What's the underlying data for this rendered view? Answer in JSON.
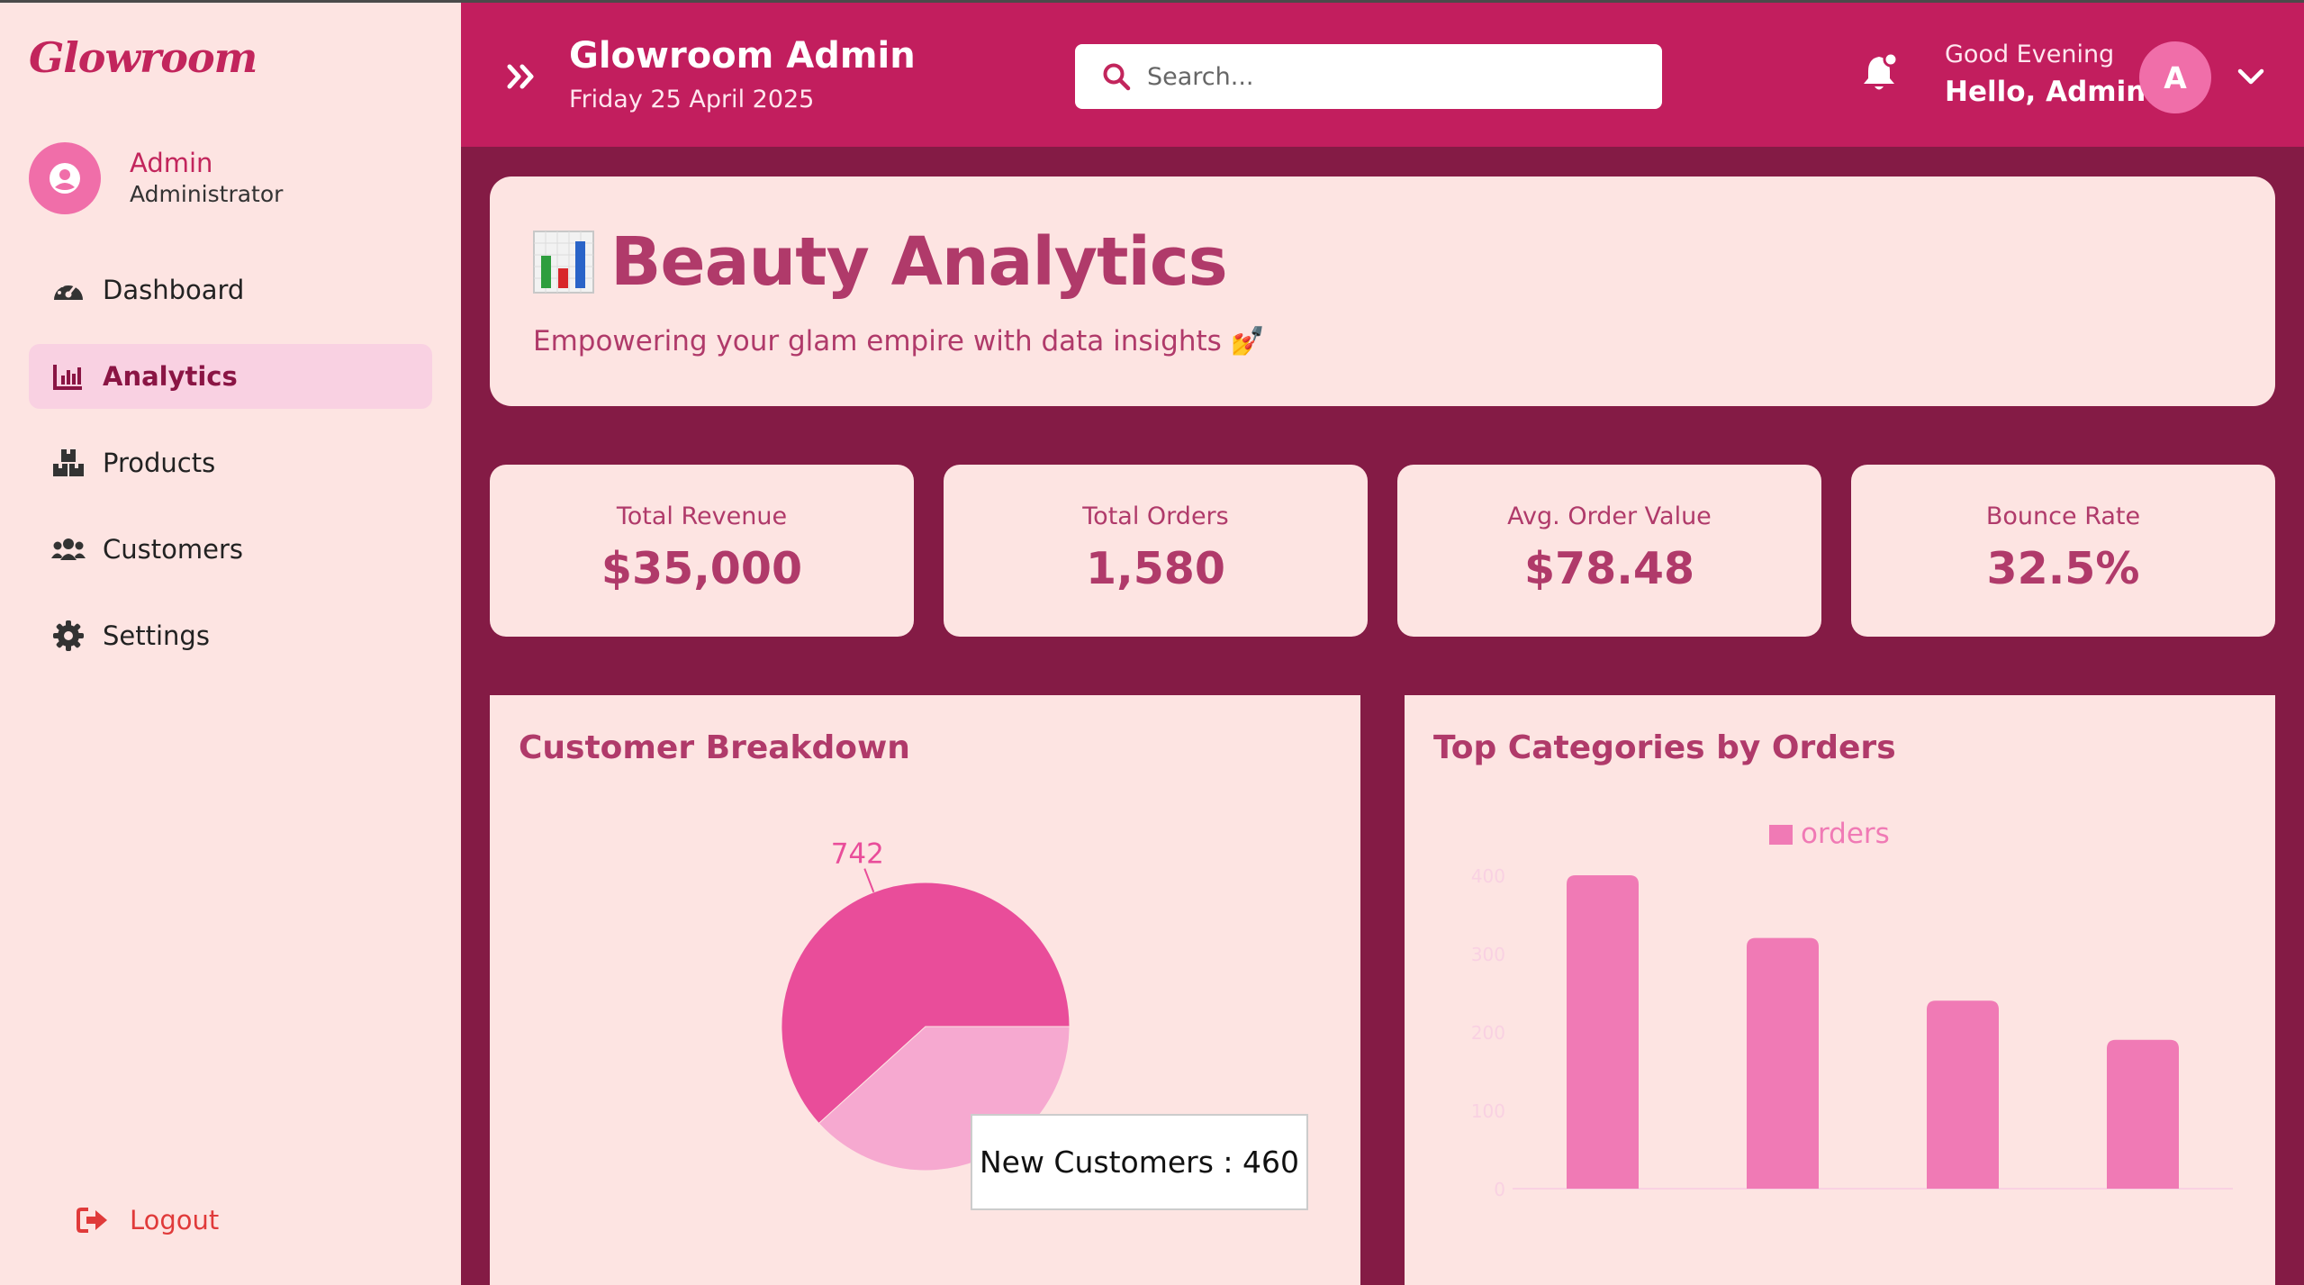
{
  "sidebar": {
    "logo": "Glowroom",
    "profile": {
      "name": "Admin",
      "role": "Administrator"
    },
    "items": [
      {
        "label": "Dashboard",
        "icon": "gauge-icon",
        "active": false
      },
      {
        "label": "Analytics",
        "icon": "bar-chart-icon",
        "active": true
      },
      {
        "label": "Products",
        "icon": "boxes-icon",
        "active": false
      },
      {
        "label": "Customers",
        "icon": "users-icon",
        "active": false
      },
      {
        "label": "Settings",
        "icon": "gear-icon",
        "active": false
      }
    ],
    "logout": "Logout"
  },
  "header": {
    "title": "Glowroom Admin",
    "date": "Friday 25 April 2025",
    "search_placeholder": "Search...",
    "greeting": "Good Evening",
    "hello": "Hello, Admin",
    "avatar_letter": "A"
  },
  "banner": {
    "title": "Beauty Analytics",
    "subtitle": "Empowering your glam empire with data insights 💅"
  },
  "stats": [
    {
      "label": "Total Revenue",
      "value": "$35,000"
    },
    {
      "label": "Total Orders",
      "value": "1,580"
    },
    {
      "label": "Avg. Order Value",
      "value": "$78.48"
    },
    {
      "label": "Bounce Rate",
      "value": "32.5%"
    }
  ],
  "panels": {
    "customer_breakdown_title": "Customer Breakdown",
    "top_categories_title": "Top Categories by Orders",
    "tooltip": "New Customers : 460"
  },
  "colors": {
    "brand": "#c21e5e",
    "background": "#841b45",
    "card": "#fde4e2",
    "accent_text": "#b03a6a",
    "pie_primary": "#e94d9a",
    "pie_secondary": "#f6a9d0",
    "bar": "#f07ab5"
  },
  "chart_data": [
    {
      "type": "pie",
      "title": "Customer Breakdown",
      "slices": [
        {
          "name": "",
          "value": 742,
          "label": "742",
          "color": "#e94d9a"
        },
        {
          "name": "New Customers",
          "value": 460,
          "color": "#f6a9d0"
        }
      ]
    },
    {
      "type": "bar",
      "title": "Top Categories by Orders",
      "legend": "orders",
      "legend_position": "top-center",
      "categories": [
        "",
        "",
        "",
        ""
      ],
      "series": [
        {
          "name": "orders",
          "values": [
            400,
            320,
            240,
            190
          ]
        }
      ],
      "ylim": [
        0,
        400
      ],
      "yticks": [
        0,
        100,
        200,
        300,
        400
      ],
      "grid": false
    }
  ]
}
